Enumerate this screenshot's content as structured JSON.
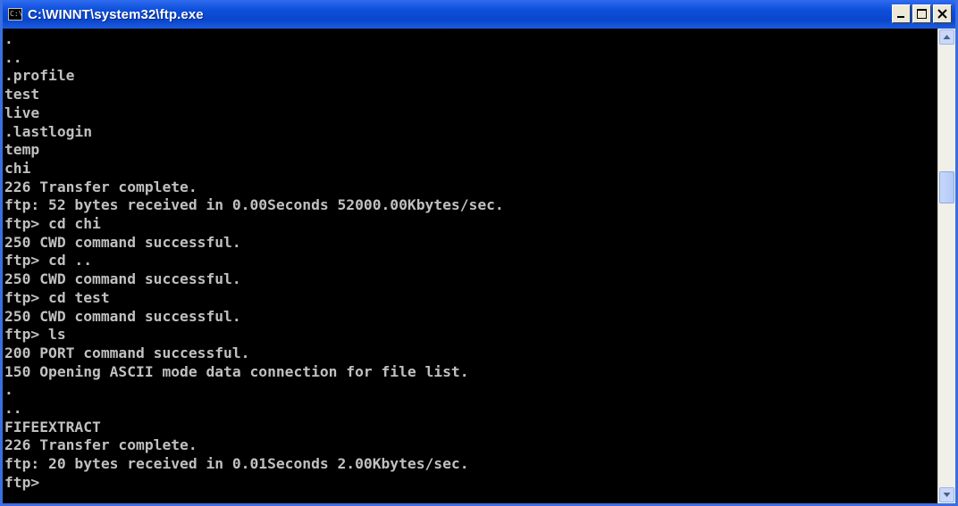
{
  "window": {
    "title": "C:\\WINNT\\system32\\ftp.exe",
    "icon": "console-icon",
    "icon_glyph": "C:\\"
  },
  "console": {
    "lines": [
      ".",
      "..",
      ".profile",
      "test",
      "live",
      ".lastlogin",
      "temp",
      "chi",
      "226 Transfer complete.",
      "ftp: 52 bytes received in 0.00Seconds 52000.00Kbytes/sec.",
      "ftp> cd chi",
      "250 CWD command successful.",
      "ftp> cd ..",
      "250 CWD command successful.",
      "ftp> cd test",
      "250 CWD command successful.",
      "ftp> ls",
      "200 PORT command successful.",
      "150 Opening ASCII mode data connection for file list.",
      ".",
      "..",
      "FIFEEXTRACT",
      "226 Transfer complete.",
      "ftp: 20 bytes received in 0.01Seconds 2.00Kbytes/sec.",
      "ftp>"
    ]
  },
  "colors": {
    "titlebar": "#0a46cc",
    "console_bg": "#000000",
    "console_fg": "#c0c0c0"
  }
}
